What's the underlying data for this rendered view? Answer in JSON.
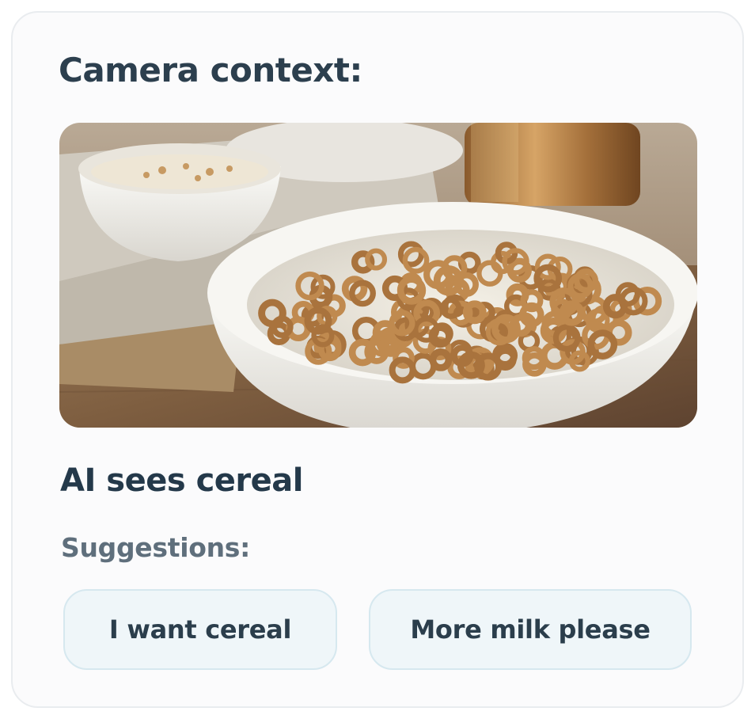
{
  "heading": "Camera context:",
  "camera": {
    "image_subject": "bowl of ring-shaped oat cereal with milk on a wooden table"
  },
  "detection": "AI sees cereal",
  "suggestions": {
    "label": "Suggestions:",
    "items": [
      {
        "label": "I want cereal"
      },
      {
        "label": "More milk please"
      }
    ]
  },
  "colors": {
    "heading": "#2c3f4e",
    "chip_background": "#eff6f9",
    "chip_border": "#d6e8ef"
  }
}
